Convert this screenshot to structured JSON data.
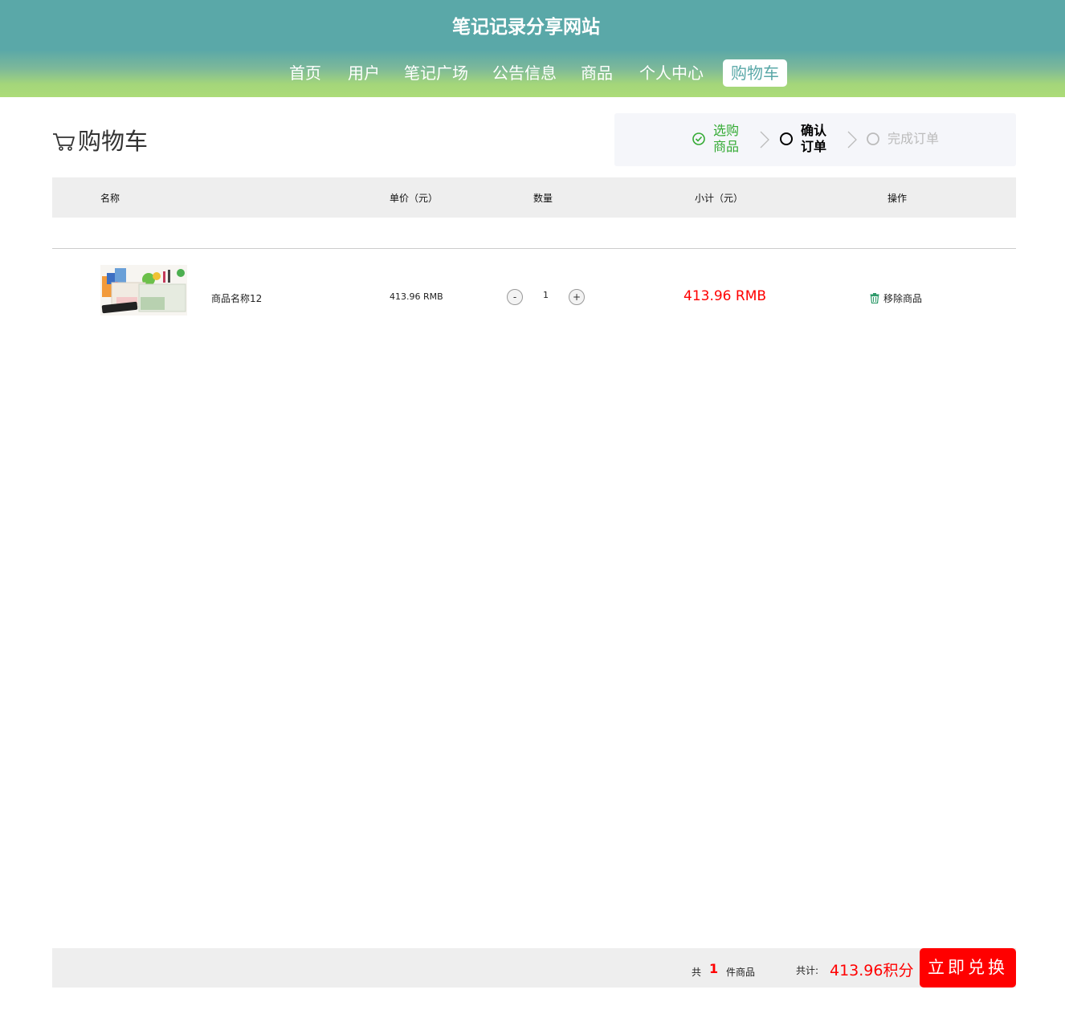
{
  "site": {
    "title": "笔记记录分享网站"
  },
  "nav": {
    "items": [
      "首页",
      "用户",
      "笔记广场",
      "公告信息",
      "商品",
      "个人中心",
      "购物车"
    ],
    "active": "购物车"
  },
  "page": {
    "title": "购物车"
  },
  "steps": [
    {
      "label": "选购商品",
      "state": "done",
      "color": "#33aa33"
    },
    {
      "label": "确认订单",
      "state": "current",
      "color": "#000000"
    },
    {
      "label": "完成订单",
      "state": "pending",
      "color": "#bbbbbb"
    }
  ],
  "table": {
    "headers": [
      "名称",
      "单价（元）",
      "数量",
      "小计（元）",
      "操作"
    ],
    "rows": [
      {
        "name": "商品名称12",
        "price": "413.96 RMB",
        "qty": "1",
        "minus": "-",
        "plus": "+",
        "subtotal": "413.96 RMB",
        "action": "移除商品"
      }
    ]
  },
  "footer": {
    "prefix": "共",
    "count": "1",
    "suffix": "件商品",
    "total_label": "共计:",
    "total_value": "413.96积分",
    "buy_label": "立即兑换"
  },
  "colors": {
    "accent": "#5aa8a8",
    "price_red": "#ff0000",
    "header_green": "#acdc78"
  }
}
